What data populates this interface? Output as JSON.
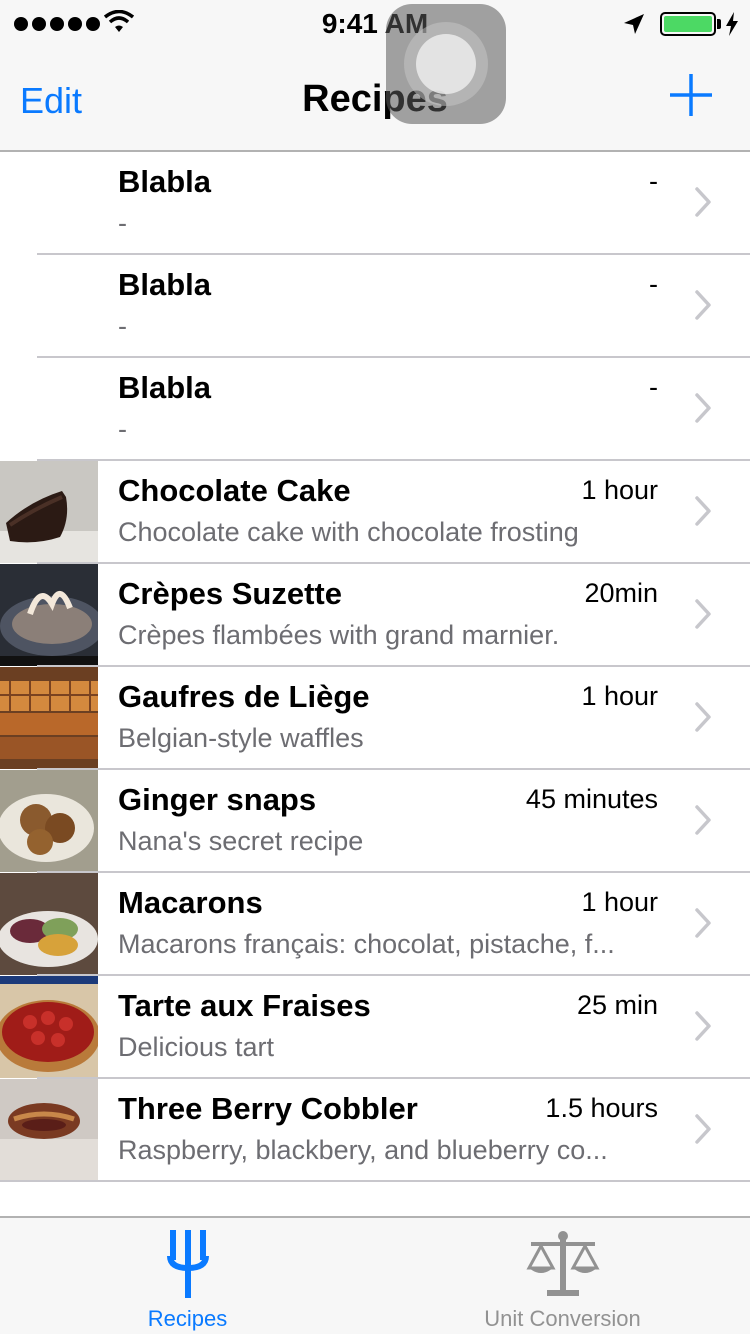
{
  "status_bar": {
    "time": "9:41 AM",
    "signal_dots": 5,
    "battery_color": "#4cd964",
    "icons": [
      "signal-dots-icon",
      "wifi-icon",
      "location-arrow-icon",
      "battery-icon",
      "charging-bolt-icon"
    ]
  },
  "nav": {
    "edit_label": "Edit",
    "title": "Recipes",
    "add_icon": "plus-icon"
  },
  "colors": {
    "accent": "#0a7aff",
    "bar_background": "#f7f7f7",
    "secondary_text": "#6d6d72",
    "separator": "#c8c7cc",
    "inactive_tab": "#929292"
  },
  "recipes": [
    {
      "title": "Blabla",
      "time": "-",
      "subtitle": "-",
      "image": "none"
    },
    {
      "title": "Blabla",
      "time": "-",
      "subtitle": "-",
      "image": "none"
    },
    {
      "title": "Blabla",
      "time": "-",
      "subtitle": "-",
      "image": "none"
    },
    {
      "title": "Chocolate Cake",
      "time": "1 hour",
      "subtitle": "Chocolate cake with chocolate frosting",
      "image": "chocolate-cake-photo"
    },
    {
      "title": "Crèpes Suzette",
      "time": "20min",
      "subtitle": "Crèpes flambées with grand marnier.",
      "image": "crepes-photo"
    },
    {
      "title": "Gaufres de Liège",
      "time": "1 hour",
      "subtitle": "Belgian-style waffles",
      "image": "waffles-photo"
    },
    {
      "title": "Ginger snaps",
      "time": "45 minutes",
      "subtitle": "Nana's secret recipe",
      "image": "ginger-snaps-photo"
    },
    {
      "title": "Macarons",
      "time": "1 hour",
      "subtitle": "Macarons français: chocolat, pistache, f...",
      "image": "macarons-photo"
    },
    {
      "title": "Tarte aux Fraises",
      "time": "25 min",
      "subtitle": "Delicious tart",
      "image": "strawberry-tart-photo"
    },
    {
      "title": "Three Berry Cobbler",
      "time": "1.5 hours",
      "subtitle": "Raspberry, blackbery, and blueberry co...",
      "image": "berry-cobbler-photo"
    }
  ],
  "tabs": [
    {
      "label": "Recipes",
      "icon": "fork-icon",
      "selected": true
    },
    {
      "label": "Unit Conversion",
      "icon": "scale-icon",
      "selected": false
    }
  ]
}
